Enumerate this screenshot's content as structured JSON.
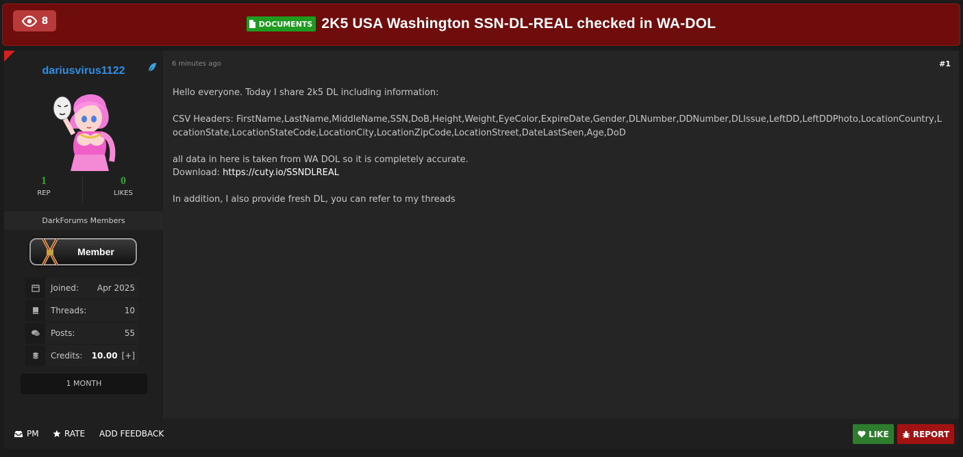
{
  "header": {
    "views_icon": "eye-icon",
    "views_count": "8",
    "badge_label": "DOCUMENTS",
    "badge_icon": "document-icon",
    "title": "2K5 USA Washington SSN-DL-REAL checked in WA-DOL"
  },
  "user": {
    "name": "dariusvirus1122",
    "name_color": "#2f8fe6",
    "rep": "1",
    "rep_label": "REP",
    "likes": "0",
    "likes_label": "LIKES",
    "group": "DarkForums Members",
    "rank_badge": "Member",
    "info": [
      {
        "icon": "calendar-icon",
        "key": "Joined:",
        "value": "Apr 2025"
      },
      {
        "icon": "book-icon",
        "key": "Threads:",
        "value": "10"
      },
      {
        "icon": "comments-icon",
        "key": "Posts:",
        "value": "55"
      },
      {
        "icon": "coins-icon",
        "key": "Credits:",
        "value": "10.00",
        "extra": "[+]"
      }
    ],
    "subscription": "1 MONTH"
  },
  "post": {
    "timestamp": "6 minutes ago",
    "number": "#1",
    "intro": "Hello everyone. Today I share 2k5 DL including information:",
    "csv_headers": "CSV Headers: FirstName,LastName,MiddleName,SSN,DoB,Height,Weight,EyeColor,ExpireDate,Gender,DLNumber,DDNumber,DLIssue,LeftDD,LeftDDPhoto,LocationCountry,LocationState,LocationStateCode,LocationCity,LocationZipCode,LocationStreet,DateLastSeen,Age,DoD",
    "accuracy": "all data in here is taken from WA DOL so it is completely accurate.",
    "download_label": "Download: ",
    "download_link": "https://cuty.io/SSNDLREAL",
    "addition": "In addition, I also provide fresh DL, you can refer to my threads"
  },
  "footer": {
    "pm": "PM",
    "rate": "RATE",
    "feedback": "ADD FEEDBACK",
    "like": "LIKE",
    "report": "REPORT"
  },
  "colors": {
    "header_bg": "#6f0c0c",
    "like_bg": "#2e7d2e",
    "report_bg": "#a11313",
    "badge_green": "#1f9b1f"
  }
}
